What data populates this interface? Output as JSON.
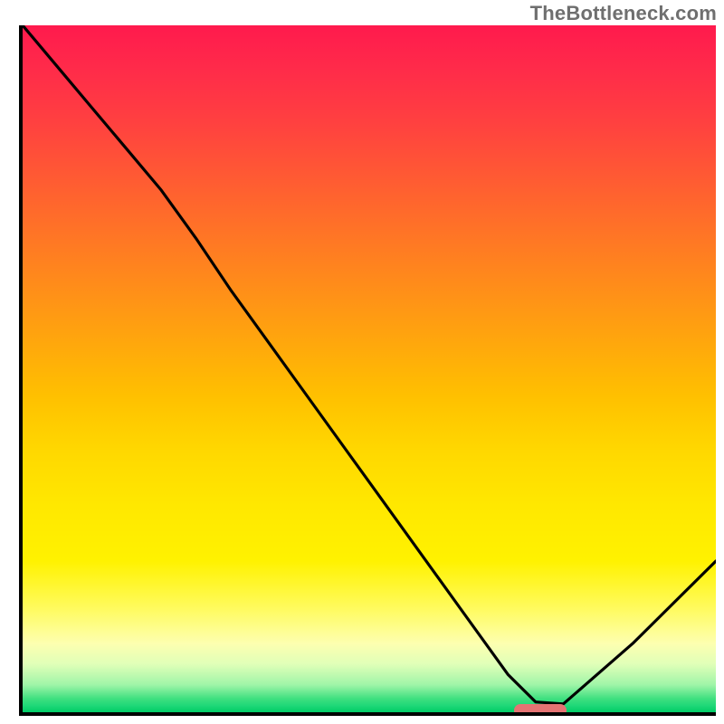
{
  "watermark": "TheBottleneck.com",
  "colors": {
    "axis": "#000000",
    "curve": "#000000",
    "marker": "#e57373",
    "watermark_text": "#6f6f6f"
  },
  "chart_data": {
    "type": "line",
    "title": "",
    "xlabel": "",
    "ylabel": "",
    "xlim": [
      0,
      100
    ],
    "ylim": [
      0,
      100
    ],
    "grid": false,
    "legend": false,
    "annotations": [
      {
        "type": "marker",
        "x_start": 70.5,
        "x_end": 78,
        "y": 0.8,
        "shape": "rounded-bar",
        "color": "#e57373"
      }
    ],
    "series": [
      {
        "name": "bottleneck-curve",
        "x": [
          0,
          5,
          10,
          15,
          20,
          25,
          30,
          40,
          50,
          60,
          70,
          74,
          78,
          88,
          100
        ],
        "y": [
          100,
          94,
          88,
          82,
          76,
          69,
          61.5,
          47.5,
          33.5,
          19.5,
          5.5,
          1.5,
          1.2,
          10,
          22
        ]
      }
    ],
    "gradient_stops": [
      {
        "pos": 0,
        "color": "#ff1a4d"
      },
      {
        "pos": 14,
        "color": "#ff4040"
      },
      {
        "pos": 34,
        "color": "#ff8020"
      },
      {
        "pos": 54,
        "color": "#ffc000"
      },
      {
        "pos": 78,
        "color": "#fff200"
      },
      {
        "pos": 93,
        "color": "#e0ffb8"
      },
      {
        "pos": 100,
        "color": "#00cc66"
      }
    ]
  }
}
